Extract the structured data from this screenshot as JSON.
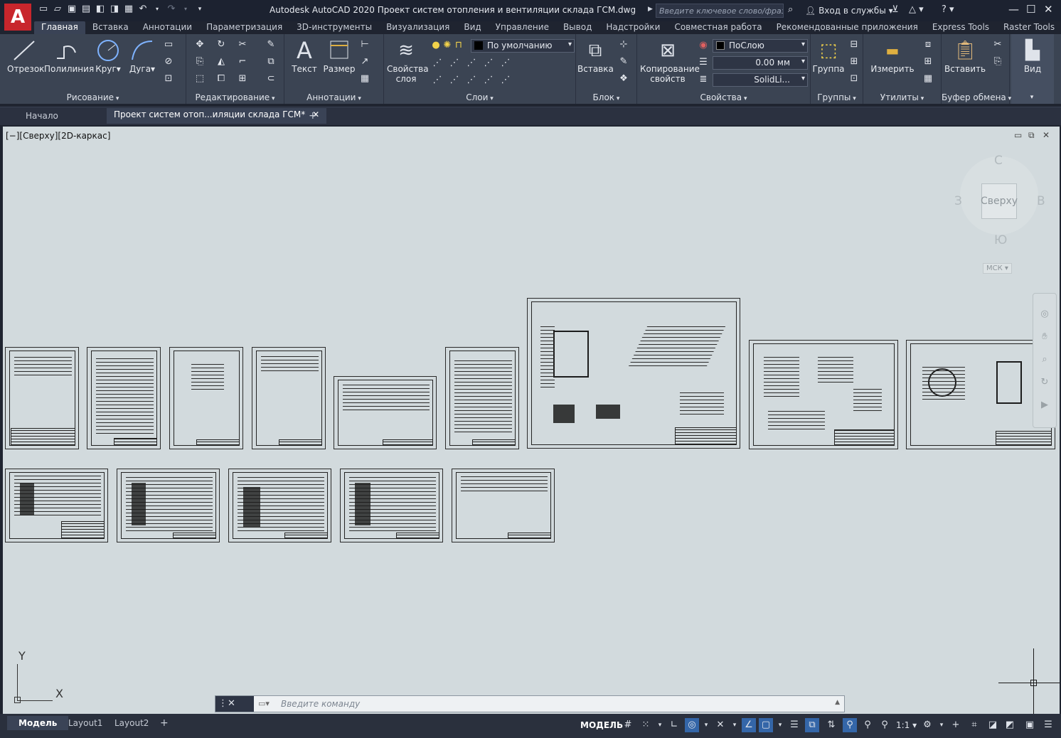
{
  "app": {
    "title": "Autodesk AutoCAD 2020   Проект систем отопления и вентиляции склада ГСМ.dwg",
    "logo": "A",
    "search_placeholder": "Введите ключевое слово/фразу",
    "signin": "Вход в службы"
  },
  "tabs": [
    "Главная",
    "Вставка",
    "Аннотации",
    "Параметризация",
    "3D-инструменты",
    "Визуализация",
    "Вид",
    "Управление",
    "Вывод",
    "Надстройки",
    "Совместная работа",
    "Рекомендованные приложения",
    "Express Tools",
    "Raster Tools"
  ],
  "ribbon": {
    "draw": {
      "title": "Рисование",
      "line": "Отрезок",
      "polyline": "Полилиния",
      "circle": "Круг",
      "arc": "Дуга"
    },
    "modify": {
      "title": "Редактирование"
    },
    "annotation": {
      "title": "Аннотации",
      "text": "Текст",
      "dimension": "Размер"
    },
    "layers": {
      "title": "Слои",
      "props_l1": "Свойства",
      "props_l2": "слоя",
      "current_layer": "По умолчанию"
    },
    "block": {
      "title": "Блок",
      "insert": "Вставка"
    },
    "properties": {
      "title": "Свойства",
      "match_l1": "Копирование",
      "match_l2": "свойств",
      "color": "ПоСлою",
      "lineweight": "0.00 мм",
      "linetype": "SolidLi..."
    },
    "groups": {
      "title": "Группы",
      "group": "Группа"
    },
    "utilities": {
      "title": "Утилиты",
      "measure": "Измерить"
    },
    "clipboard": {
      "title": "Буфер обмена",
      "paste": "Вставить"
    },
    "view": {
      "label": "Вид"
    }
  },
  "doc_tabs": {
    "start": "Начало",
    "active": "Проект систем отоп...иляции склада ГСМ*"
  },
  "viewport": {
    "label": "[−][Сверху][2D-каркас]",
    "viewcube": {
      "top": "Сверху",
      "north": "С",
      "south": "Ю",
      "west": "З",
      "east": "В",
      "ucs": "МСК"
    },
    "ucs_y": "Y",
    "ucs_x": "X"
  },
  "command": {
    "placeholder": "Введите команду"
  },
  "status": {
    "layouts": [
      "Модель",
      "Layout1",
      "Layout2"
    ],
    "mode": "МОДЕЛЬ",
    "scale": "1:1"
  }
}
